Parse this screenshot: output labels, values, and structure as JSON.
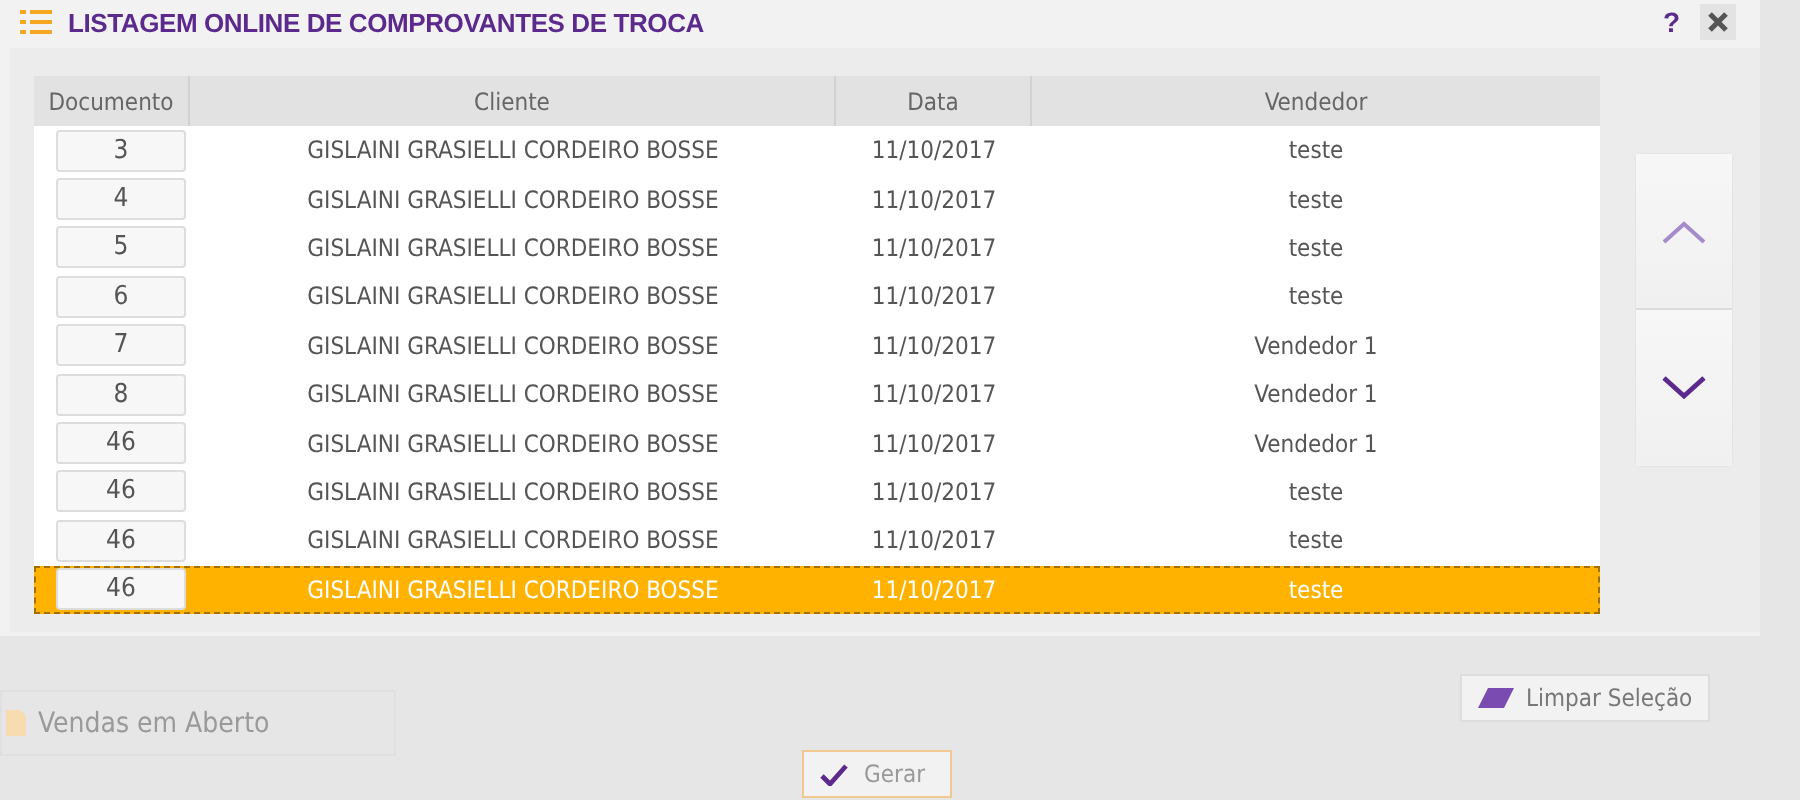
{
  "window": {
    "title": "LISTAGEM ONLINE DE COMPROVANTES DE TROCA",
    "help": "?"
  },
  "table": {
    "columns": [
      "Documento",
      "Cliente",
      "Data",
      "Vendedor"
    ],
    "rows": [
      {
        "documento": "3",
        "cliente": "GISLAINI GRASIELLI CORDEIRO BOSSE",
        "data": "11/10/2017",
        "vendedor": "teste",
        "selected": false
      },
      {
        "documento": "4",
        "cliente": "GISLAINI GRASIELLI CORDEIRO BOSSE",
        "data": "11/10/2017",
        "vendedor": "teste",
        "selected": false
      },
      {
        "documento": "5",
        "cliente": "GISLAINI GRASIELLI CORDEIRO BOSSE",
        "data": "11/10/2017",
        "vendedor": "teste",
        "selected": false
      },
      {
        "documento": "6",
        "cliente": "GISLAINI GRASIELLI CORDEIRO BOSSE",
        "data": "11/10/2017",
        "vendedor": "teste",
        "selected": false
      },
      {
        "documento": "7",
        "cliente": "GISLAINI GRASIELLI CORDEIRO BOSSE",
        "data": "11/10/2017",
        "vendedor": "Vendedor 1",
        "selected": false
      },
      {
        "documento": "8",
        "cliente": "GISLAINI GRASIELLI CORDEIRO BOSSE",
        "data": "11/10/2017",
        "vendedor": "Vendedor 1",
        "selected": false
      },
      {
        "documento": "46",
        "cliente": "GISLAINI GRASIELLI CORDEIRO BOSSE",
        "data": "11/10/2017",
        "vendedor": "Vendedor 1",
        "selected": false
      },
      {
        "documento": "46",
        "cliente": "GISLAINI GRASIELLI CORDEIRO BOSSE",
        "data": "11/10/2017",
        "vendedor": "teste",
        "selected": false
      },
      {
        "documento": "46",
        "cliente": "GISLAINI GRASIELLI CORDEIRO BOSSE",
        "data": "11/10/2017",
        "vendedor": "teste",
        "selected": false
      },
      {
        "documento": "46",
        "cliente": "GISLAINI GRASIELLI CORDEIRO BOSSE",
        "data": "11/10/2017",
        "vendedor": "teste",
        "selected": true
      }
    ]
  },
  "background": {
    "tab": "Vendas em Aberto"
  },
  "buttons": {
    "clear": "Limpar Seleção",
    "generate": "Gerar"
  }
}
